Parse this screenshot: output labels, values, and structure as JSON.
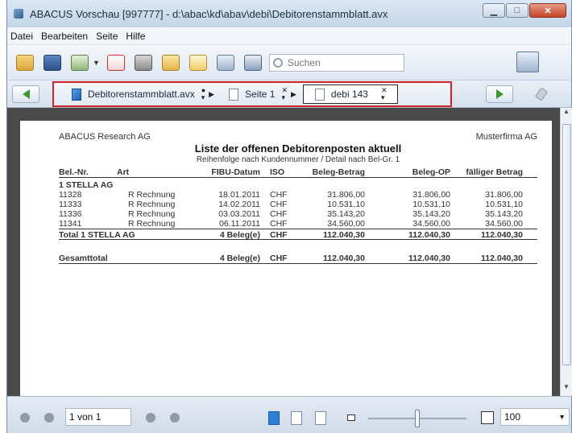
{
  "window": {
    "title": "ABACUS Vorschau [997777]  - d:\\abac\\kd\\abav\\debi\\Debitorenstammblatt.avx"
  },
  "menu": {
    "items": [
      "Datei",
      "Bearbeiten",
      "Seite",
      "Hilfe"
    ]
  },
  "toolbar": {
    "search_placeholder": "Suchen",
    "icons": [
      "folder-open-icon",
      "save-icon",
      "screen-icon",
      "pdf-icon",
      "print-icon",
      "folder-icon",
      "edit-icon",
      "preview-icon",
      "user-icon"
    ]
  },
  "tabs": [
    {
      "label": "Debitorenstammblatt.avx",
      "active": false
    },
    {
      "label": "Seite 1",
      "active": false
    },
    {
      "label": "debi 143",
      "active": true
    }
  ],
  "report": {
    "company_left": "ABACUS Research AG",
    "company_right": "Musterfirma AG",
    "title": "Liste der offenen Debitorenposten aktuell",
    "subtitle": "Reihenfolge nach Kundennummer / Detail nach Bel-Gr. 1",
    "columns": [
      "Bel.-Nr.",
      "Art",
      "FIBU-Datum",
      "ISO",
      "Beleg-Betrag",
      "Beleg-OP",
      "fälliger Betrag"
    ],
    "group_title": "1 STELLA AG",
    "rows": [
      {
        "nr": "11328",
        "art": "R  Rechnung",
        "datum": "18.01.2011",
        "iso": "CHF",
        "betrag": "31.806,00",
        "op": "31.806,00",
        "faellig": "31.806,00"
      },
      {
        "nr": "11333",
        "art": "R  Rechnung",
        "datum": "14.02.2011",
        "iso": "CHF",
        "betrag": "10.531,10",
        "op": "10.531,10",
        "faellig": "10.531,10"
      },
      {
        "nr": "11336",
        "art": "R  Rechnung",
        "datum": "03.03.2011",
        "iso": "CHF",
        "betrag": "35.143,20",
        "op": "35.143,20",
        "faellig": "35.143,20"
      },
      {
        "nr": "11341",
        "art": "R  Rechnung",
        "datum": "06.11.2011",
        "iso": "CHF",
        "betrag": "34.560,00",
        "op": "34.560,00",
        "faellig": "34.560,00"
      }
    ],
    "total": {
      "label": "Total 1 STELLA AG",
      "count": "4 Beleg(e)",
      "iso": "CHF",
      "betrag": "112.040,30",
      "op": "112.040,30",
      "faellig": "112.040,30"
    },
    "grand": {
      "label": "Gesamttotal",
      "count": "4 Beleg(e)",
      "iso": "CHF",
      "betrag": "112.040,30",
      "op": "112.040,30",
      "faellig": "112.040,30"
    }
  },
  "statusbar": {
    "page_value": "1 von 1",
    "zoom": "100",
    "zoom_slider_fraction": 0.5
  }
}
